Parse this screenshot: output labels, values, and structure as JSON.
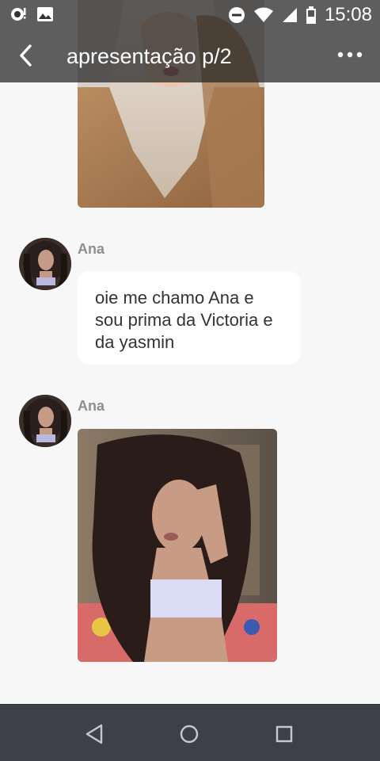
{
  "status_bar": {
    "time": "15:08",
    "icons": [
      "notification-icon",
      "image-icon",
      "do-not-disturb-icon",
      "wifi-icon",
      "cell-signal-icon",
      "battery-icon"
    ]
  },
  "header": {
    "title": "apresentação p/2",
    "back_icon": "chevron-left-icon",
    "more_icon": "more-dots-icon"
  },
  "messages": [
    {
      "type": "image",
      "description": "photo-blonde-sweater"
    },
    {
      "type": "text",
      "sender": "Ana",
      "text": "oie me chamo Ana e sou prima da Victoria e da yasmin"
    },
    {
      "type": "image",
      "sender": "Ana",
      "description": "photo-curly-hair"
    }
  ],
  "nav": {
    "back_icon": "triangle-back-icon",
    "home_icon": "circle-home-icon",
    "recents_icon": "square-recents-icon"
  },
  "colors": {
    "header_bg": "#232323",
    "chat_bg": "#f7f7f7",
    "bubble_bg": "#ffffff",
    "nav_bg": "#3d4147",
    "sender_name": "#8f8f8f"
  }
}
